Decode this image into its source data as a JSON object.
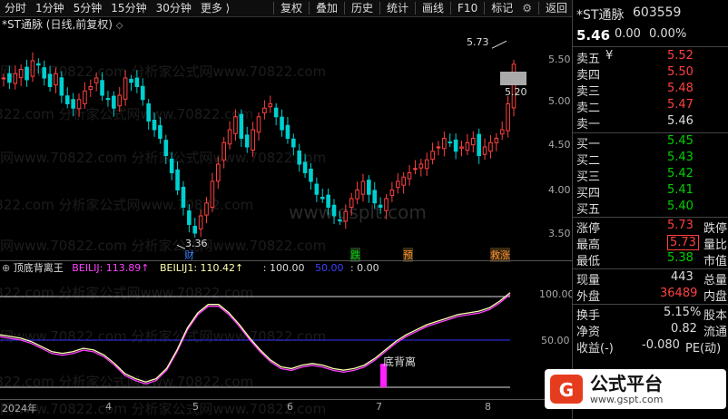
{
  "toolbar": {
    "items": [
      "分时",
      "1分钟",
      "5分钟",
      "15分钟",
      "30分钟",
      "更多 ⟩"
    ],
    "right_items": [
      "复权",
      "叠加",
      "历史",
      "统计",
      "画线",
      "F10",
      "标记",
      "返回"
    ],
    "gear": "⚙"
  },
  "title": {
    "text": "*ST通脉 (日线,前复权)",
    "circle": "◇"
  },
  "chart": {
    "y_axis": [
      "5.50",
      "5.00",
      "4.50",
      "4.00",
      "3.50"
    ],
    "high_label": "5.73",
    "low_label": "3.36",
    "price_box": "5.20",
    "markers": [
      {
        "text": "财",
        "color": "#4080ff"
      },
      {
        "text": "跌",
        "color": "#00d000"
      },
      {
        "text": "预",
        "color": "#ff9030"
      },
      {
        "text": "救涨",
        "color": "#ff9030"
      }
    ],
    "ind_y_axis": [
      "100.00",
      "50.00",
      "0.00"
    ],
    "signal_label": "底背离",
    "x_axis": [
      "2024年",
      "4",
      "5",
      "6",
      "7",
      "8"
    ]
  },
  "indicator": {
    "name": "顶底背离王",
    "l1": "BEILIJ: 113.89↑",
    "l2": "BEILIJ1: 110.42↑",
    "l3": ": 100.00",
    "l4": "50.00",
    "l5": ": 0.00"
  },
  "watermark": "网www.70822.com 分析家公式网www.70822.com",
  "watermark2": "www.gsplt.com",
  "stock": {
    "name": "*ST通脉",
    "code": "603559",
    "price": "5.46",
    "change": "0.00",
    "pct": "0.00%"
  },
  "orderbook": {
    "sell": [
      {
        "label": "卖五",
        "extra": "¥",
        "price": "5.52"
      },
      {
        "label": "卖四",
        "price": "5.50"
      },
      {
        "label": "卖三",
        "price": "5.48"
      },
      {
        "label": "卖二",
        "price": "5.47"
      },
      {
        "label": "卖一",
        "price": "5.46"
      }
    ],
    "buy": [
      {
        "label": "买一",
        "price": "5.45"
      },
      {
        "label": "买二",
        "price": "5.43"
      },
      {
        "label": "买三",
        "price": "5.42"
      },
      {
        "label": "买四",
        "price": "5.41"
      },
      {
        "label": "买五",
        "price": "5.40"
      }
    ]
  },
  "stats": [
    {
      "l1": "涨停",
      "v1": "5.73",
      "l2": "跌停",
      "v2": ""
    },
    {
      "l1": "最高",
      "v1": "5.73",
      "l2": "量比",
      "v2": ""
    },
    {
      "l1": "最低",
      "v1": "5.38",
      "l2": "市值",
      "v2": ""
    },
    {
      "l1": "现量",
      "v1": "443",
      "l2": "总量",
      "v2": ""
    },
    {
      "l1": "外盘",
      "v1": "36489",
      "l2": "内盘",
      "v2": ""
    },
    {
      "l1": "换手",
      "v1": "5.15%",
      "l2": "股本",
      "v2": ""
    },
    {
      "l1": "净资",
      "v1": "0.82",
      "l2": "流通",
      "v2": ""
    },
    {
      "l1": "收益(-)",
      "v1": "-0.080",
      "l2": "PE(动)",
      "v2": ""
    }
  ],
  "brand": {
    "name": "公式平台",
    "url": "www.gspt.com"
  },
  "colors": {
    "up": "#ff4040",
    "down": "#00d0d0",
    "line1": "#ff40ff",
    "line2": "#ffffb0"
  }
}
